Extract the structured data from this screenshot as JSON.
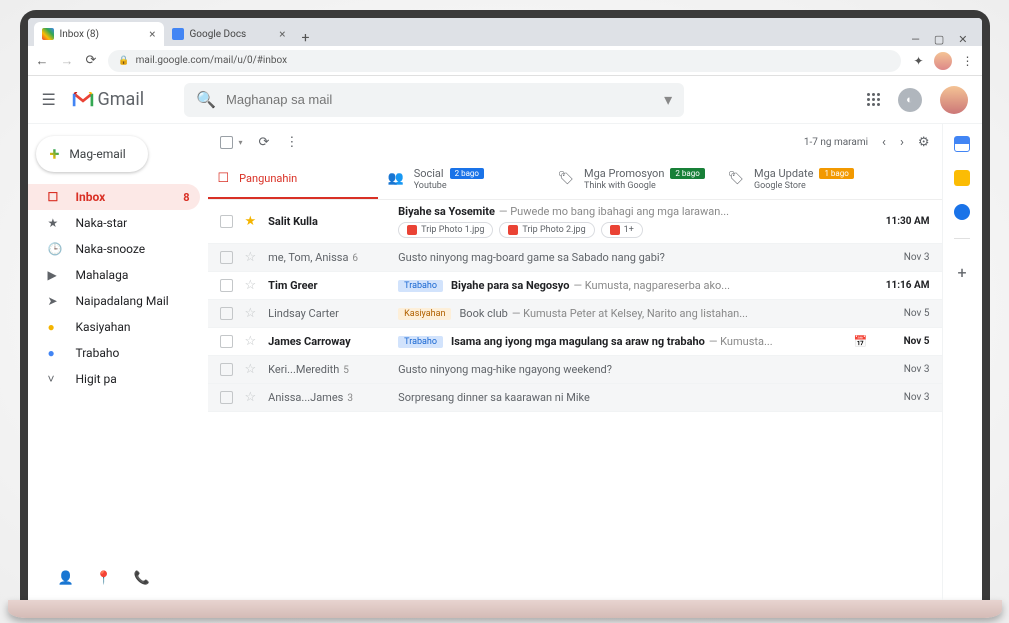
{
  "browser": {
    "tabs": [
      {
        "title": "Inbox (8)",
        "active": true
      },
      {
        "title": "Google Docs",
        "active": false
      }
    ],
    "url": "mail.google.com/mail/u/0/#inbox"
  },
  "header": {
    "app_name": "Gmail",
    "search_placeholder": "Maghanap sa mail"
  },
  "compose_label": "Mag-email",
  "sidebar": {
    "items": [
      {
        "icon": "inbox",
        "label": "Inbox",
        "count": "8",
        "active": true
      },
      {
        "icon": "star",
        "label": "Naka-star"
      },
      {
        "icon": "clock",
        "label": "Naka-snooze"
      },
      {
        "icon": "bookmark",
        "label": "Mahalaga"
      },
      {
        "icon": "send",
        "label": "Naipadalang Mail"
      },
      {
        "icon": "tag-yellow",
        "label": "Kasiyahan"
      },
      {
        "icon": "tag-blue",
        "label": "Trabaho"
      },
      {
        "icon": "chevron",
        "label": "Higit pa"
      }
    ]
  },
  "toolbar": {
    "range": "1-7 ng marami"
  },
  "categories": [
    {
      "label": "Pangunahin",
      "sub": "",
      "active": true
    },
    {
      "label": "Social",
      "sub": "Youtube",
      "badge": "2 bago",
      "badge_color": "blue"
    },
    {
      "label": "Mga Promosyon",
      "sub": "Think with Google",
      "badge": "2 bago",
      "badge_color": "green"
    },
    {
      "label": "Mga Update",
      "sub": "Google Store",
      "badge": "1 bago",
      "badge_color": "orange"
    }
  ],
  "emails": [
    {
      "sender": "Salit Kulla",
      "starred": true,
      "unread": true,
      "subject": "Biyahe sa Yosemite",
      "snippet": "Puwede mo bang ibahagi ang mga larawan...",
      "date": "11:30 AM",
      "attachments": [
        "Trip Photo 1.jpg",
        "Trip Photo 2.jpg",
        "1+"
      ]
    },
    {
      "sender": "me, Tom, Anissa",
      "thread": "6",
      "unread": false,
      "subject": "Gusto ninyong mag-board game sa Sabado nang gabi?",
      "snippet": "",
      "date": "Nov 3"
    },
    {
      "sender": "Tim Greer",
      "unread": true,
      "chip": "Trabaho",
      "chip_color": "blue",
      "subject": "Biyahe para sa Negosyo",
      "snippet": "Kumusta, nagpareserba ako...",
      "date": "11:16 AM"
    },
    {
      "sender": "Lindsay Carter",
      "unread": false,
      "chip": "Kasiyahan",
      "chip_color": "yellow",
      "subject": "Book club",
      "snippet": "Kumusta Peter at Kelsey, Narito ang listahan...",
      "date": "Nov 5"
    },
    {
      "sender": "James Carroway",
      "unread": true,
      "chip": "Trabaho",
      "chip_color": "blue",
      "subject": "Isama ang iyong mga magulang sa araw ng trabaho",
      "snippet": "Kumusta...",
      "date": "Nov 5",
      "has_event": true
    },
    {
      "sender": "Keri...Meredith",
      "thread": "5",
      "unread": false,
      "subject": "Gusto ninyong mag-hike ngayong weekend?",
      "snippet": "",
      "date": "Nov 3"
    },
    {
      "sender": "Anissa...James",
      "thread": "3",
      "unread": false,
      "subject": "Sorpresang dinner sa kaarawan ni Mike",
      "snippet": "",
      "date": "Nov 3"
    }
  ]
}
